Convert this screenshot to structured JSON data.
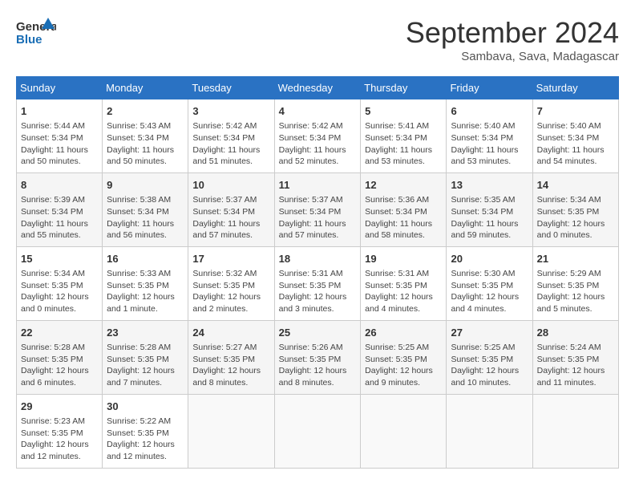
{
  "header": {
    "logo_line1": "General",
    "logo_line2": "Blue",
    "title": "September 2024",
    "location": "Sambava, Sava, Madagascar"
  },
  "calendar": {
    "days_of_week": [
      "Sunday",
      "Monday",
      "Tuesday",
      "Wednesday",
      "Thursday",
      "Friday",
      "Saturday"
    ],
    "weeks": [
      [
        null,
        {
          "day": 2,
          "sunrise": "5:43 AM",
          "sunset": "5:34 PM",
          "daylight": "11 hours and 50 minutes."
        },
        {
          "day": 3,
          "sunrise": "5:42 AM",
          "sunset": "5:34 PM",
          "daylight": "11 hours and 51 minutes."
        },
        {
          "day": 4,
          "sunrise": "5:42 AM",
          "sunset": "5:34 PM",
          "daylight": "11 hours and 52 minutes."
        },
        {
          "day": 5,
          "sunrise": "5:41 AM",
          "sunset": "5:34 PM",
          "daylight": "11 hours and 53 minutes."
        },
        {
          "day": 6,
          "sunrise": "5:40 AM",
          "sunset": "5:34 PM",
          "daylight": "11 hours and 53 minutes."
        },
        {
          "day": 7,
          "sunrise": "5:40 AM",
          "sunset": "5:34 PM",
          "daylight": "11 hours and 54 minutes."
        }
      ],
      [
        {
          "day": 1,
          "sunrise": "5:44 AM",
          "sunset": "5:34 PM",
          "daylight": "11 hours and 50 minutes."
        },
        {
          "day": 8,
          "sunrise": "5:39 AM",
          "sunset": "5:34 PM",
          "daylight": "11 hours and 55 minutes."
        },
        {
          "day": 9,
          "sunrise": "5:38 AM",
          "sunset": "5:34 PM",
          "daylight": "11 hours and 56 minutes."
        },
        {
          "day": 10,
          "sunrise": "5:37 AM",
          "sunset": "5:34 PM",
          "daylight": "11 hours and 57 minutes."
        },
        {
          "day": 11,
          "sunrise": "5:37 AM",
          "sunset": "5:34 PM",
          "daylight": "11 hours and 57 minutes."
        },
        {
          "day": 12,
          "sunrise": "5:36 AM",
          "sunset": "5:34 PM",
          "daylight": "11 hours and 58 minutes."
        },
        {
          "day": 13,
          "sunrise": "5:35 AM",
          "sunset": "5:34 PM",
          "daylight": "11 hours and 59 minutes."
        },
        {
          "day": 14,
          "sunrise": "5:34 AM",
          "sunset": "5:35 PM",
          "daylight": "12 hours and 0 minutes."
        }
      ],
      [
        {
          "day": 15,
          "sunrise": "5:34 AM",
          "sunset": "5:35 PM",
          "daylight": "12 hours and 0 minutes."
        },
        {
          "day": 16,
          "sunrise": "5:33 AM",
          "sunset": "5:35 PM",
          "daylight": "12 hours and 1 minute."
        },
        {
          "day": 17,
          "sunrise": "5:32 AM",
          "sunset": "5:35 PM",
          "daylight": "12 hours and 2 minutes."
        },
        {
          "day": 18,
          "sunrise": "5:31 AM",
          "sunset": "5:35 PM",
          "daylight": "12 hours and 3 minutes."
        },
        {
          "day": 19,
          "sunrise": "5:31 AM",
          "sunset": "5:35 PM",
          "daylight": "12 hours and 4 minutes."
        },
        {
          "day": 20,
          "sunrise": "5:30 AM",
          "sunset": "5:35 PM",
          "daylight": "12 hours and 4 minutes."
        },
        {
          "day": 21,
          "sunrise": "5:29 AM",
          "sunset": "5:35 PM",
          "daylight": "12 hours and 5 minutes."
        }
      ],
      [
        {
          "day": 22,
          "sunrise": "5:28 AM",
          "sunset": "5:35 PM",
          "daylight": "12 hours and 6 minutes."
        },
        {
          "day": 23,
          "sunrise": "5:28 AM",
          "sunset": "5:35 PM",
          "daylight": "12 hours and 7 minutes."
        },
        {
          "day": 24,
          "sunrise": "5:27 AM",
          "sunset": "5:35 PM",
          "daylight": "12 hours and 8 minutes."
        },
        {
          "day": 25,
          "sunrise": "5:26 AM",
          "sunset": "5:35 PM",
          "daylight": "12 hours and 8 minutes."
        },
        {
          "day": 26,
          "sunrise": "5:25 AM",
          "sunset": "5:35 PM",
          "daylight": "12 hours and 9 minutes."
        },
        {
          "day": 27,
          "sunrise": "5:25 AM",
          "sunset": "5:35 PM",
          "daylight": "12 hours and 10 minutes."
        },
        {
          "day": 28,
          "sunrise": "5:24 AM",
          "sunset": "5:35 PM",
          "daylight": "12 hours and 11 minutes."
        }
      ],
      [
        {
          "day": 29,
          "sunrise": "5:23 AM",
          "sunset": "5:35 PM",
          "daylight": "12 hours and 12 minutes."
        },
        {
          "day": 30,
          "sunrise": "5:22 AM",
          "sunset": "5:35 PM",
          "daylight": "12 hours and 12 minutes."
        },
        null,
        null,
        null,
        null,
        null
      ]
    ]
  }
}
